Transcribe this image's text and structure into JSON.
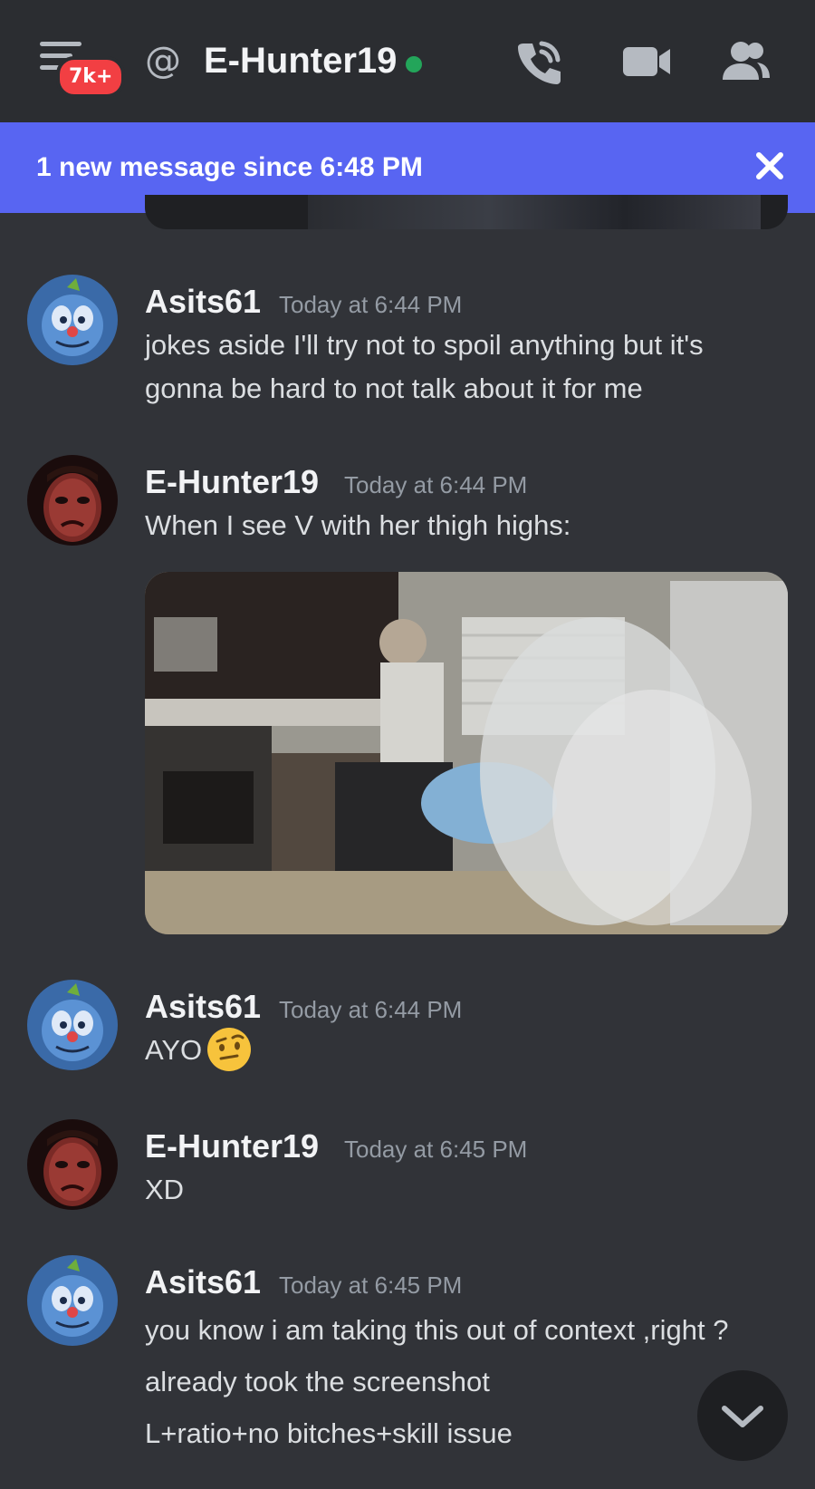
{
  "header": {
    "notification_badge": "7k+",
    "at_symbol": "@",
    "channel_name": "E-Hunter19",
    "status": "online",
    "status_color": "#23a55a",
    "icons": [
      "menu-icon",
      "phone-call-icon",
      "video-camera-icon",
      "members-icon"
    ]
  },
  "banner": {
    "text": "1 new message since 6:48 PM",
    "close_icon": "close-icon"
  },
  "messages": [
    {
      "author": "Asits61",
      "time": "Today at 6:44 PM",
      "lines": [
        "jokes aside I'll try not to spoil anything but it's",
        "gonna be hard to not talk about it for me"
      ]
    },
    {
      "author": "E-Hunter19",
      "time": "Today at 6:44 PM",
      "lines": [
        "When I see V with her thigh highs:"
      ],
      "attachment": "gif-image"
    },
    {
      "author": "Asits61",
      "time": "Today at 6:44 PM",
      "lines": [
        "AYO"
      ],
      "emoji": "face-with-raised-eyebrow-emoji"
    },
    {
      "author": "E-Hunter19",
      "time": "Today at 6:45 PM",
      "lines": [
        "XD"
      ]
    },
    {
      "author": "Asits61",
      "time": "Today at 6:45 PM",
      "lines": [
        "you know i am taking this out of context ,right ?",
        "already took the screenshot",
        "L+ratio+no bitches+skill issue"
      ]
    }
  ],
  "scroll_button": "chevron-down-icon",
  "colors": {
    "background": "#313338",
    "header": "#2b2d31",
    "banner": "#5865f2",
    "badge": "#f23f43"
  }
}
